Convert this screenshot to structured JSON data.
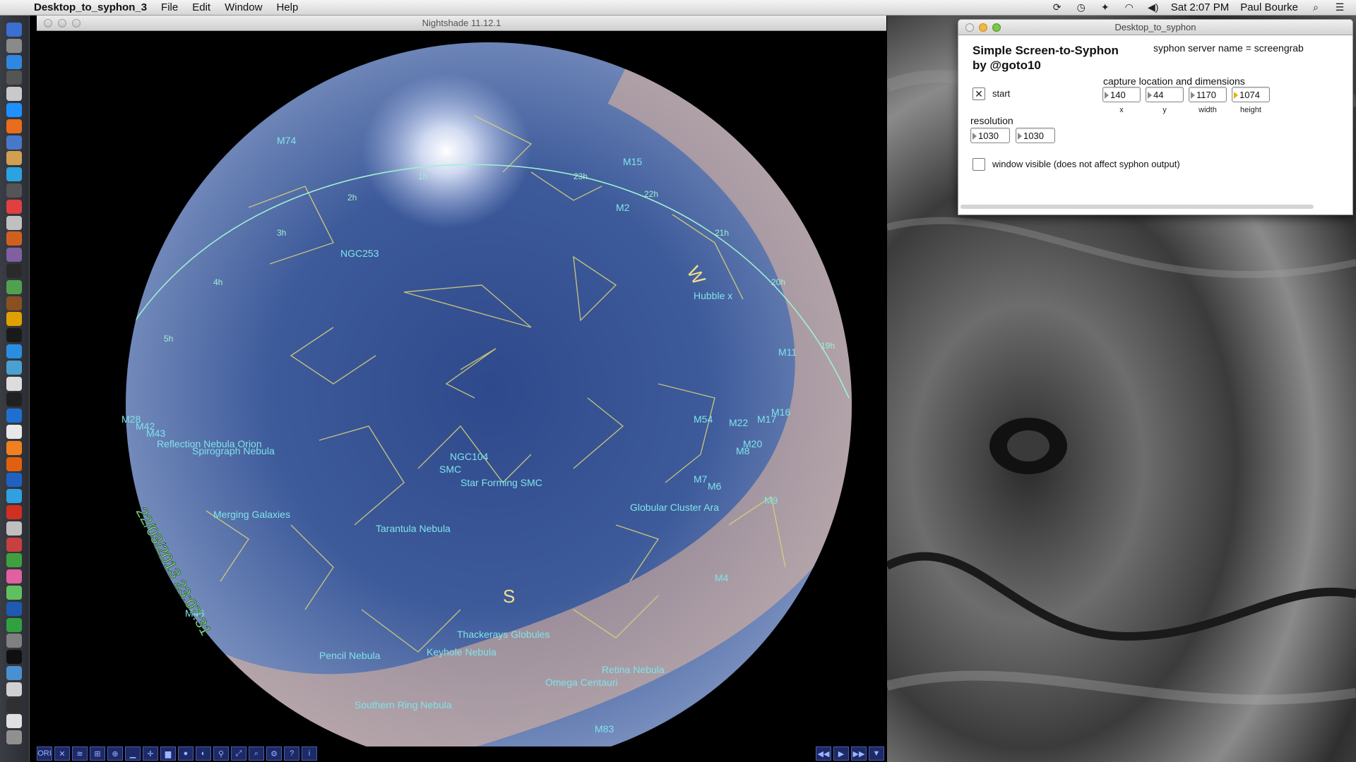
{
  "menubar": {
    "app_name": "Desktop_to_syphon_3",
    "menus": [
      "File",
      "Edit",
      "Window",
      "Help"
    ],
    "clock": "Sat 2:07 PM",
    "user": "Paul Bourke"
  },
  "nightshade": {
    "window_title": "Nightshade 11.12.1",
    "datetime_overlay": "22/03/2013 23:07:31",
    "cardinals": [
      "W",
      "S"
    ],
    "ra_hours": [
      "1h",
      "2h",
      "3h",
      "4h",
      "5h",
      "23h",
      "22h",
      "21h",
      "20h",
      "19h"
    ],
    "labels": [
      "M74",
      "M15",
      "M2",
      "NGC253",
      "Hubble x",
      "NGC104",
      "SMC",
      "Star Forming SMC",
      "Tarantula Nebula",
      "Globular Cluster Ara",
      "Thackerays Globules",
      "Keyhole Nebula",
      "Omega Centauri",
      "Retina Nebula",
      "Pencil Nebula",
      "Southern Ring Nebula",
      "M83",
      "M4",
      "M9",
      "M7",
      "M6",
      "M8",
      "M20",
      "M22",
      "M54",
      "M17",
      "M16",
      "M11",
      "M28",
      "M42",
      "M43",
      "Reflection Nebula Orion",
      "Spirograph Nebula",
      "Merging Galaxies",
      "M46"
    ],
    "toolbar_left": [
      "ORI",
      "",
      "",
      "",
      "",
      "",
      "",
      "",
      "",
      "",
      "",
      "",
      "",
      "",
      "?",
      "i"
    ],
    "toolbar_right": [
      "◀◀",
      "▶",
      "▶▶",
      "▼"
    ]
  },
  "syphon": {
    "window_title": "Desktop_to_syphon",
    "heading_line1": "Simple Screen-to-Syphon",
    "heading_line2": "by @goto10",
    "server_name": "syphon server name = screengrab",
    "start_label": "start",
    "start_checked": true,
    "capture_label": "capture location and dimensions",
    "x_value": "140",
    "y_value": "44",
    "width_value": "1170",
    "height_value": "1074",
    "x_caption": "x",
    "y_caption": "y",
    "width_caption": "width",
    "height_caption": "height",
    "resolution_label": "resolution",
    "res_w": "1030",
    "res_h": "1030",
    "window_visible_label": "window visible (does not affect syphon output)",
    "window_visible_checked": false
  },
  "colors": {
    "label_cyan": "#7fe3ea",
    "constellation_line": "#d9d27a",
    "meridian": "#9ff0d0",
    "sky_blue": "#3e5a98",
    "milkyway_peach": "#e8b89a"
  }
}
